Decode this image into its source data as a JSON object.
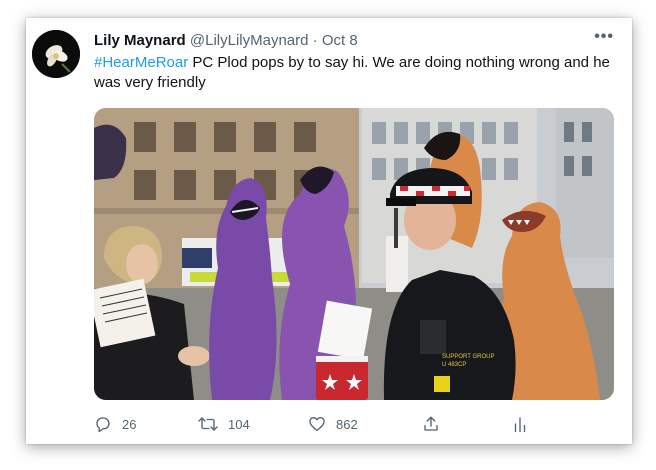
{
  "tweet": {
    "author_name": "Lily Maynard",
    "author_handle": "@LilyLilyMaynard",
    "separator": "·",
    "date": "Oct 8",
    "hashtag": "#HearMeRoar",
    "body_text": " PC Plod pops by to say hi. We are doing nothing wrong and he was very friendly",
    "more_label": "•••",
    "media_alt_icon": "photo-protest-inflatable-dinosaurs",
    "uniform_badge_text": "U 483CP",
    "uniform_role_text": "SUPPORT GROUP"
  },
  "actions": {
    "reply": {
      "icon": "reply-icon",
      "count": "26"
    },
    "retweet": {
      "icon": "retweet-icon",
      "count": "104"
    },
    "like": {
      "icon": "heart-icon",
      "count": "862"
    },
    "share": {
      "icon": "share-icon"
    },
    "analytics": {
      "icon": "analytics-icon"
    }
  },
  "colors": {
    "hashtag": "#1d9bf0",
    "name": "#0f1419",
    "secondary": "#536471",
    "dino_purple": "#7a4aa8",
    "dino_orange": "#d9894a"
  }
}
